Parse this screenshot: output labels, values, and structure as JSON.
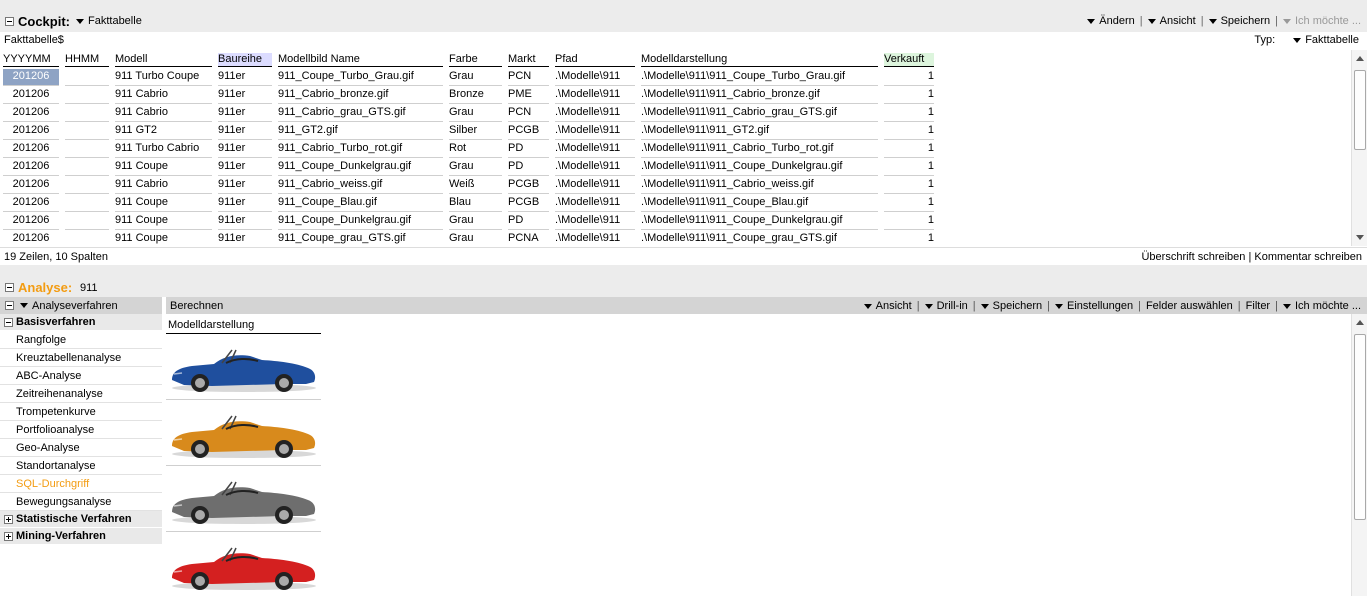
{
  "cockpit": {
    "title": "Cockpit:",
    "subtitle": "Fakttabelle",
    "toolbar": [
      "Ändern",
      "Ansicht",
      "Speichern"
    ],
    "toolbar_more": "Ich möchte ..."
  },
  "table": {
    "name": "Fakttabelle$",
    "type_label": "Typ:",
    "type_value": "Fakttabelle",
    "columns": [
      "YYYYMM",
      "HHMM",
      "Modell",
      "Baureihe",
      "Modellbild Name",
      "Farbe",
      "Markt",
      "Pfad",
      "Modelldarstellung",
      "Verkauft"
    ],
    "rows": [
      [
        "201206",
        "",
        "911 Turbo Coupe",
        "911er",
        "911_Coupe_Turbo_Grau.gif",
        "Grau",
        "PCN",
        ".\\Modelle\\911",
        ".\\Modelle\\911\\911_Coupe_Turbo_Grau.gif",
        "1"
      ],
      [
        "201206",
        "",
        "911 Cabrio",
        "911er",
        "911_Cabrio_bronze.gif",
        "Bronze",
        "PME",
        ".\\Modelle\\911",
        ".\\Modelle\\911\\911_Cabrio_bronze.gif",
        "1"
      ],
      [
        "201206",
        "",
        "911 Cabrio",
        "911er",
        "911_Cabrio_grau_GTS.gif",
        "Grau",
        "PCN",
        ".\\Modelle\\911",
        ".\\Modelle\\911\\911_Cabrio_grau_GTS.gif",
        "1"
      ],
      [
        "201206",
        "",
        "911 GT2",
        "911er",
        "911_GT2.gif",
        "Silber",
        "PCGB",
        ".\\Modelle\\911",
        ".\\Modelle\\911\\911_GT2.gif",
        "1"
      ],
      [
        "201206",
        "",
        "911 Turbo Cabrio",
        "911er",
        "911_Cabrio_Turbo_rot.gif",
        "Rot",
        "PD",
        ".\\Modelle\\911",
        ".\\Modelle\\911\\911_Cabrio_Turbo_rot.gif",
        "1"
      ],
      [
        "201206",
        "",
        "911 Coupe",
        "911er",
        "911_Coupe_Dunkelgrau.gif",
        "Grau",
        "PD",
        ".\\Modelle\\911",
        ".\\Modelle\\911\\911_Coupe_Dunkelgrau.gif",
        "1"
      ],
      [
        "201206",
        "",
        "911 Cabrio",
        "911er",
        "911_Cabrio_weiss.gif",
        "Weiß",
        "PCGB",
        ".\\Modelle\\911",
        ".\\Modelle\\911\\911_Cabrio_weiss.gif",
        "1"
      ],
      [
        "201206",
        "",
        "911 Coupe",
        "911er",
        "911_Coupe_Blau.gif",
        "Blau",
        "PCGB",
        ".\\Modelle\\911",
        ".\\Modelle\\911\\911_Coupe_Blau.gif",
        "1"
      ],
      [
        "201206",
        "",
        "911 Coupe",
        "911er",
        "911_Coupe_Dunkelgrau.gif",
        "Grau",
        "PD",
        ".\\Modelle\\911",
        ".\\Modelle\\911\\911_Coupe_Dunkelgrau.gif",
        "1"
      ],
      [
        "201206",
        "",
        "911 Coupe",
        "911er",
        "911_Coupe_grau_GTS.gif",
        "Grau",
        "PCNA",
        ".\\Modelle\\911",
        ".\\Modelle\\911\\911_Coupe_grau_GTS.gif",
        "1"
      ]
    ],
    "status": "19 Zeilen, 10 Spalten",
    "actions": "Überschrift schreiben | Kommentar schreiben"
  },
  "analyse": {
    "title": "Analyse:",
    "subtitle": "911",
    "panel_header": "Analyseverfahren",
    "groups": [
      {
        "label": "Basisverfahren",
        "expanded": true,
        "items": [
          "Rangfolge",
          "Kreuztabellenanalyse",
          "ABC-Analyse",
          "Zeitreihenanalyse",
          "Trompetenkurve",
          "Portfolioanalyse",
          "Geo-Analyse",
          "Standortanalyse",
          "SQL-Durchgriff",
          "Bewegungsanalyse"
        ]
      },
      {
        "label": "Statistische Verfahren",
        "expanded": false,
        "items": []
      },
      {
        "label": "Mining-Verfahren",
        "expanded": false,
        "items": []
      }
    ],
    "active_item": "SQL-Durchgriff",
    "berechnen": "Berechnen",
    "toolbar": [
      "Ansicht",
      "Drill-in",
      "Speichern",
      "Einstellungen"
    ],
    "toolbar_plain": [
      "Felder auswählen",
      "Filter"
    ],
    "toolbar_more": "Ich möchte ...",
    "result_column": "Modelldarstellung",
    "car_colors": [
      "#1f4f9e",
      "#d88a1c",
      "#6e6e6e",
      "#d42020"
    ]
  },
  "colors": {
    "accent": "#f39c12",
    "selection": "#8ea3c4"
  }
}
